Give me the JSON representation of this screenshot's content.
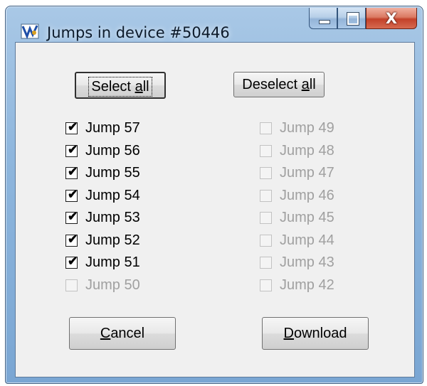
{
  "window": {
    "title": "Jumps in device #50446",
    "close_glyph": "X",
    "icons": [
      "app-icon",
      "minimize-icon",
      "maximize-icon",
      "close-icon"
    ]
  },
  "buttons": {
    "select_all_pre": "Select ",
    "select_all_mnemonic": "a",
    "select_all_post": "ll",
    "deselect_all_pre": "Deselect ",
    "deselect_all_mnemonic": "a",
    "deselect_all_post": "ll",
    "cancel_mnemonic": "C",
    "cancel_post": "ancel",
    "download_mnemonic": "D",
    "download_post": "ownload"
  },
  "jumps_left": [
    {
      "label": "Jump 57",
      "checked": true,
      "enabled": true
    },
    {
      "label": "Jump 56",
      "checked": true,
      "enabled": true
    },
    {
      "label": "Jump 55",
      "checked": true,
      "enabled": true
    },
    {
      "label": "Jump 54",
      "checked": true,
      "enabled": true
    },
    {
      "label": "Jump 53",
      "checked": true,
      "enabled": true
    },
    {
      "label": "Jump 52",
      "checked": true,
      "enabled": true
    },
    {
      "label": "Jump 51",
      "checked": true,
      "enabled": true
    },
    {
      "label": "Jump 50",
      "checked": false,
      "enabled": false
    }
  ],
  "jumps_right": [
    {
      "label": "Jump 49",
      "checked": false,
      "enabled": false
    },
    {
      "label": "Jump 48",
      "checked": false,
      "enabled": false
    },
    {
      "label": "Jump 47",
      "checked": false,
      "enabled": false
    },
    {
      "label": "Jump 46",
      "checked": false,
      "enabled": false
    },
    {
      "label": "Jump 45",
      "checked": false,
      "enabled": false
    },
    {
      "label": "Jump 44",
      "checked": false,
      "enabled": false
    },
    {
      "label": "Jump 43",
      "checked": false,
      "enabled": false
    },
    {
      "label": "Jump 42",
      "checked": false,
      "enabled": false
    }
  ],
  "colors": {
    "enabled_text": "#000000",
    "disabled_text": "#a0a0a0",
    "close_button": "#c3412a",
    "title_bar": "#8eb6dd"
  }
}
